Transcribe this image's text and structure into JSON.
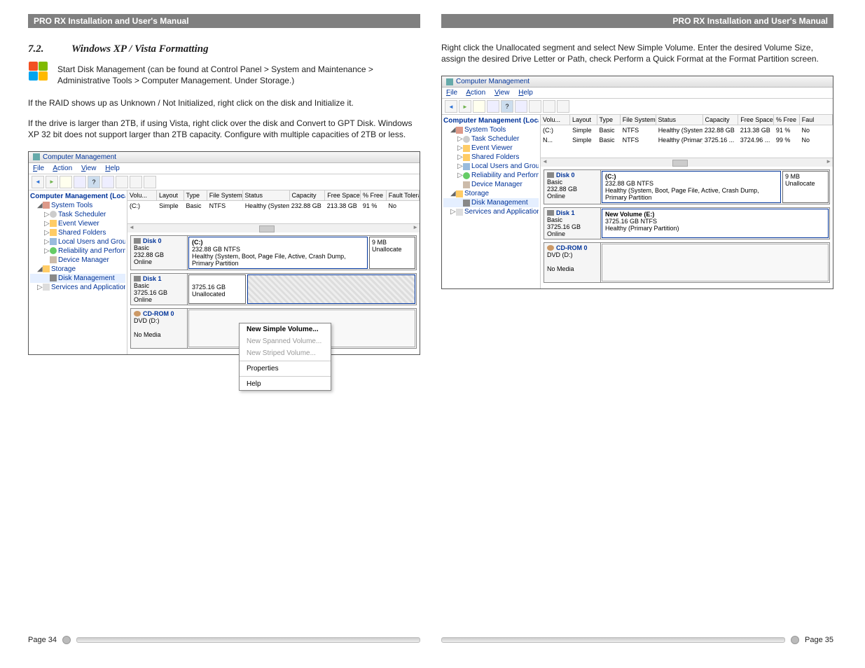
{
  "doc_title": "PRO RX Installation and User's Manual",
  "left": {
    "section_num": "7.2.",
    "section_title": "Windows XP / Vista Formatting",
    "p1": "Start Disk Management (can be found at Control Panel > System and Maintenance > Administrative Tools > Computer Management.  Under Storage.)",
    "p2": "If the RAID shows up as Unknown / Not Initialized, right click on the disk and Initialize it.",
    "p3": "If the drive is larger than 2TB, if using Vista,  right click over the disk and Convert to GPT Disk.  Windows XP 32 bit does not support larger than 2TB capacity.  Configure with multiple capacities of 2TB or less.",
    "page_label": "Page 34"
  },
  "right": {
    "p1": "Right click the Unallocated segment and select New Simple Volume.  Enter the desired Volume Size, assign the desired Drive Letter or Path, check Perform a Quick Format at the Format Partition screen.",
    "page_label": "Page 35"
  },
  "cm": {
    "title": "Computer Management",
    "menu": [
      "File",
      "Action",
      "View",
      "Help"
    ],
    "tree": {
      "root": "Computer Management (Local",
      "system_tools": "System Tools",
      "items_sys": [
        "Task Scheduler",
        "Event Viewer",
        "Shared Folders",
        "Local Users and Groups",
        "Reliability and Performa",
        "Device Manager"
      ],
      "storage": "Storage",
      "disk_mgmt": "Disk Management",
      "services": "Services and Applications"
    },
    "cols": [
      "Volu...",
      "Layout",
      "Type",
      "File System",
      "Status",
      "Capacity",
      "Free Space",
      "% Free",
      "Fault Toleran"
    ],
    "cols2": [
      "Volu...",
      "Layout",
      "Type",
      "File System",
      "Status",
      "Capacity",
      "Free Space",
      "% Free",
      "Faul"
    ]
  },
  "vol_row1": {
    "v": "(C:)",
    "lay": "Simple",
    "typ": "Basic",
    "fs": "NTFS",
    "stat": "Healthy (System, Boot, Page File, Ac...",
    "cap": "232.88 GB",
    "free": "213.38 GB",
    "pct": "91 %",
    "ft": "No"
  },
  "vol_row2": {
    "v": "N...",
    "lay": "Simple",
    "typ": "Basic",
    "fs": "NTFS",
    "stat": "Healthy (Primary Partition)",
    "cap": "3725.16 ...",
    "free": "3724.96 ...",
    "pct": "99 %",
    "ft": "No"
  },
  "disk0": {
    "name": "Disk 0",
    "type": "Basic",
    "size": "232.88 GB",
    "state": "Online",
    "part_name": "(C:)",
    "part_sub": "232.88 GB NTFS",
    "part_stat": "Healthy (System, Boot, Page File, Active, Crash Dump, Primary Partition",
    "side1": "9 MB",
    "side2": "Unallocate"
  },
  "disk1_l": {
    "name": "Disk 1",
    "type": "Basic",
    "size": "3725.16 GB",
    "state": "Online",
    "part_sub": "3725.16 GB",
    "part_stat": "Unallocated"
  },
  "disk1_r": {
    "name": "Disk 1",
    "type": "Basic",
    "size": "3725.16 GB",
    "state": "Online",
    "part_name": "New Volume  (E:)",
    "part_sub": "3725.16 GB NTFS",
    "part_stat": "Healthy (Primary Partition)"
  },
  "cdrom": {
    "name": "CD-ROM 0",
    "sub": "DVD (D:)",
    "state": "No Media"
  },
  "ctx": {
    "i1": "New Simple Volume...",
    "i2": "New Spanned Volume...",
    "i3": "New Striped Volume...",
    "i4": "Properties",
    "i5": "Help"
  }
}
